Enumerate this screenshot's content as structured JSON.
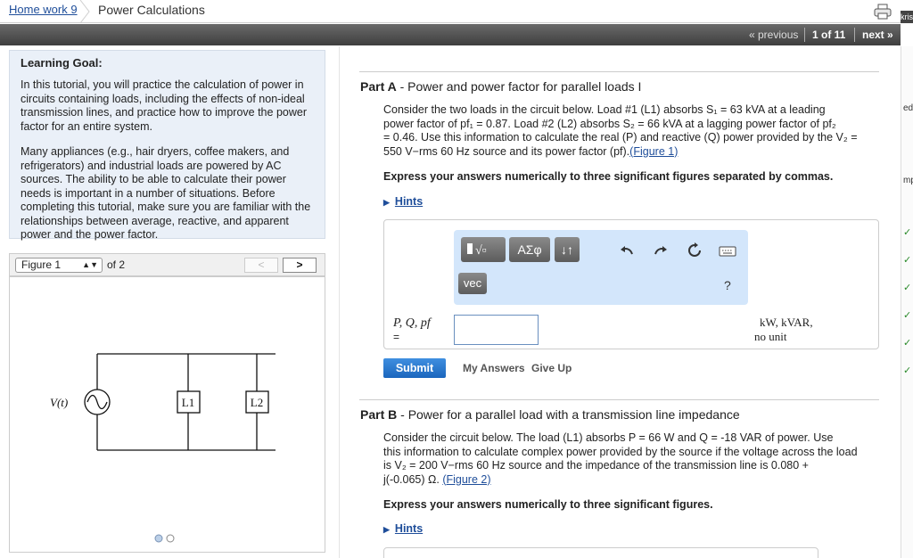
{
  "breadcrumb": {
    "home": "Home work 9",
    "current": "Power Calculations"
  },
  "nav": {
    "previous": "« previous",
    "count": "1 of 11",
    "next": "next »"
  },
  "right_edge": {
    "top_text": "kris",
    "edit": "edit",
    "mp": "mp",
    "check": "✓"
  },
  "goal": {
    "title": "Learning Goal:",
    "p1": "In this tutorial, you will practice the calculation of power in circuits containing loads, including the effects of non-ideal transmission lines, and practice how to improve the power factor for an entire system.",
    "p2": "Many appliances (e.g., hair dryers, coffee makers, and refrigerators) and industrial loads are powered by AC sources. The ability to be able to calculate their power needs is important in a number of situations. Before completing this tutorial, make sure you are familiar with the relationships between average, reactive, and apparent power and the power factor."
  },
  "figure": {
    "select": "Figure 1",
    "of": "of 2",
    "prev": "<",
    "next": ">",
    "source_label": "V(t)",
    "load1": "L1",
    "load2": "L2"
  },
  "partA": {
    "label": "Part A",
    "title": "Power and power factor for parallel loads I",
    "body_1": "Consider the two loads in the circuit below. Load #1 (L1) absorbs S₁ = 63 kVA at a leading",
    "body_2": "power factor of pf₁ = 0.87. Load #2 (L2) absorbs S₂ = 66 kVA at a lagging power factor of pf₂",
    "body_3": "= 0.46. Use this information to calculate the real (P) and reactive (Q) power provided by the V₂ =",
    "body_4": "550 V−rms 60 Hz source and its power factor (pf).",
    "figure_link": "(Figure 1)",
    "express": "Express your answers numerically to three significant figures separated by commas.",
    "hints": "Hints"
  },
  "toolbar": {
    "greek": "ΑΣφ",
    "arrows": "↓↑",
    "vec": "vec",
    "help": "?"
  },
  "answer": {
    "label": "P, Q, pf",
    "eq": "=",
    "value": "",
    "units1": "kW, kVAR,",
    "units2": "no unit"
  },
  "actions": {
    "submit": "Submit",
    "my_answers": "My Answers",
    "give_up": "Give Up"
  },
  "partB": {
    "label": "Part B",
    "title": "Power for a parallel load with a transmission line impedance",
    "body_1": "Consider the circuit below. The load (L1) absorbs P = 66 W and Q = -18 VAR of power. Use",
    "body_2": "this information to calculate complex power provided by the source if the voltage across the load",
    "body_3": "is V₂ = 200 V−rms 60 Hz source and the impedance of the transmission line is 0.080 +",
    "body_4": "j(-0.065) Ω.",
    "figure_link": "(Figure 2)",
    "express": "Express your answers numerically to three significant figures.",
    "hints": "Hints"
  },
  "colors": {
    "link": "#1f4e9a",
    "toolbar_bg": "#d3e6fb",
    "submit": "#1b66bd",
    "goal_bg": "#eaf0f8"
  }
}
